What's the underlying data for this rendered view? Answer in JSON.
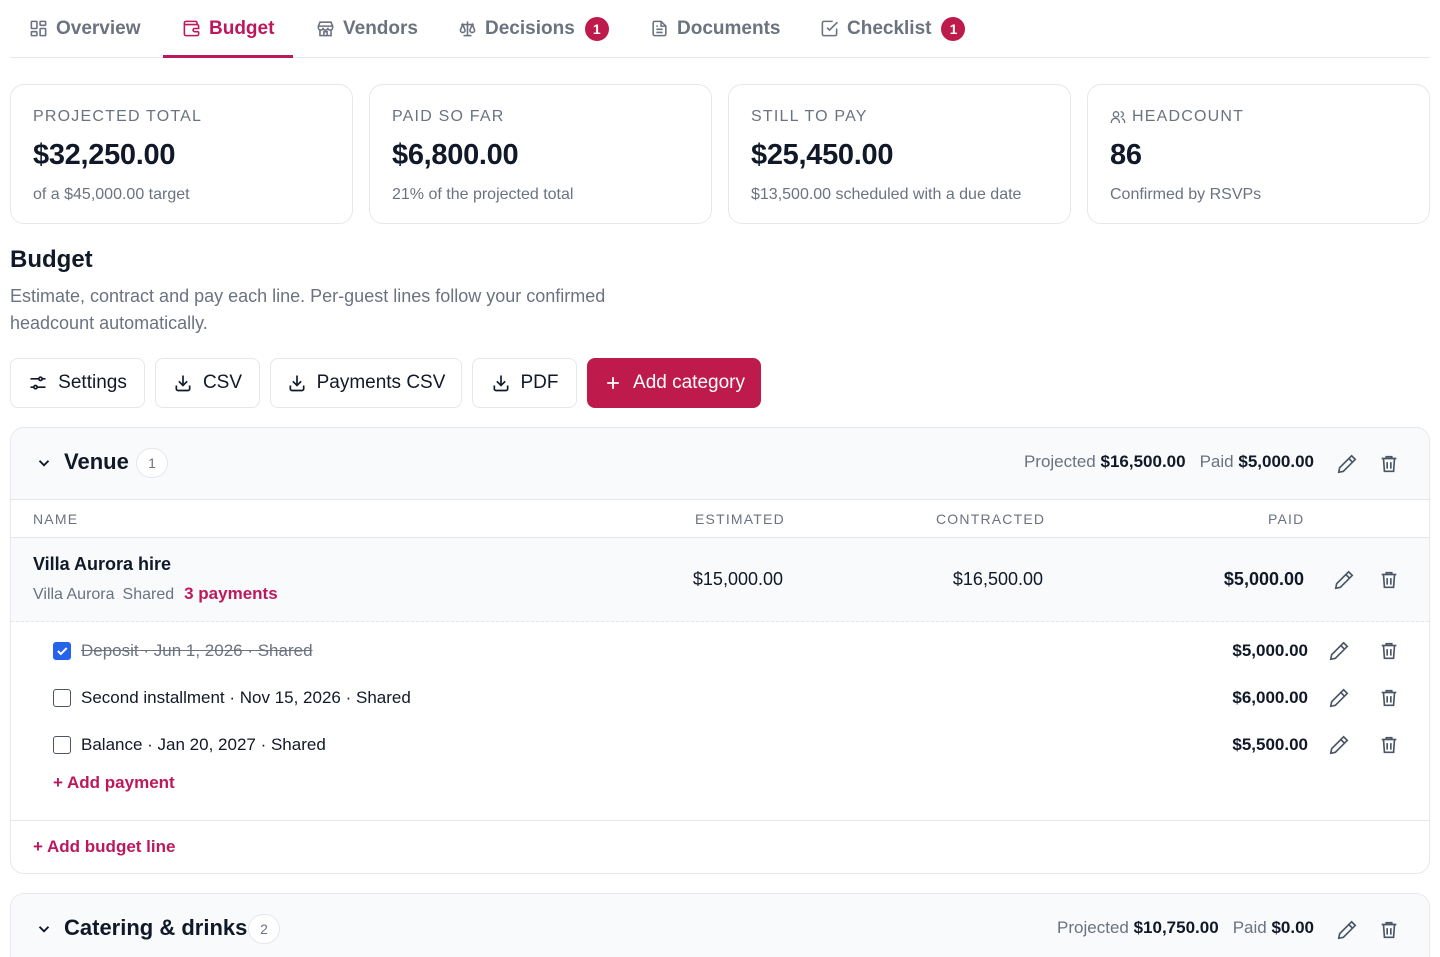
{
  "tabs": [
    {
      "label": "Overview",
      "icon": "grid-icon"
    },
    {
      "label": "Budget",
      "icon": "wallet-icon",
      "active": true
    },
    {
      "label": "Vendors",
      "icon": "store-icon"
    },
    {
      "label": "Decisions",
      "icon": "scale-icon",
      "badge": "1"
    },
    {
      "label": "Documents",
      "icon": "document-icon"
    },
    {
      "label": "Checklist",
      "icon": "checkbox-icon",
      "badge": "1"
    }
  ],
  "stats": [
    {
      "label": "PROJECTED TOTAL",
      "value": "$32,250.00",
      "sub": "of a $45,000.00 target"
    },
    {
      "label": "PAID SO FAR",
      "value": "$6,800.00",
      "sub": "21% of the projected total"
    },
    {
      "label": "STILL TO PAY",
      "value": "$25,450.00",
      "sub": "$13,500.00 scheduled with a due date"
    },
    {
      "label": "HEADCOUNT",
      "value": "86",
      "sub": "Confirmed by RSVPs",
      "icon": "users-icon"
    }
  ],
  "section": {
    "title": "Budget",
    "description": "Estimate, contract and pay each line. Per-guest lines follow your confirmed headcount automatically."
  },
  "toolbar": {
    "settings": "Settings",
    "csv": "CSV",
    "payments_csv": "Payments CSV",
    "pdf": "PDF",
    "add_category": "Add category"
  },
  "columns": {
    "name": "NAME",
    "estimated": "ESTIMATED",
    "contracted": "CONTRACTED",
    "paid": "PAID"
  },
  "categories": [
    {
      "name": "Venue",
      "count": "1",
      "projected_label": "Projected",
      "projected": "$16,500.00",
      "paid_label": "Paid",
      "paid": "$5,000.00",
      "lines": [
        {
          "name": "Villa Aurora hire",
          "vendor": "Villa Aurora",
          "split": "Shared",
          "payments_link": "3 payments",
          "estimated": "$15,000.00",
          "contracted": "$16,500.00",
          "paid": "$5,000.00",
          "payments": [
            {
              "text": "Deposit · Jun 1, 2026 · Shared",
              "amount": "$5,000.00",
              "paid": true
            },
            {
              "text": "Second installment · Nov 15, 2026 · Shared",
              "amount": "$6,000.00",
              "paid": false
            },
            {
              "text": "Balance · Jan 20, 2027 · Shared",
              "amount": "$5,500.00",
              "paid": false
            }
          ]
        }
      ],
      "add_payment": "+ Add payment",
      "add_line": "+ Add budget line"
    },
    {
      "name": "Catering & drinks",
      "count": "2",
      "projected_label": "Projected",
      "projected": "$10,750.00",
      "paid_label": "Paid",
      "paid": "$0.00"
    }
  ]
}
